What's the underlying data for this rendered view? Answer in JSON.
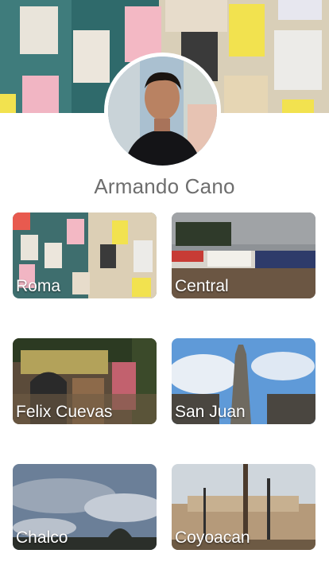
{
  "profile": {
    "name": "Armando Cano"
  },
  "neighborhoods": [
    {
      "label": "Roma"
    },
    {
      "label": "Central"
    },
    {
      "label": "Felix Cuevas"
    },
    {
      "label": "San Juan"
    },
    {
      "label": "Chalco"
    },
    {
      "label": "Coyoacan"
    }
  ],
  "colors": {
    "background": "#ffffff",
    "name_text": "#6e6e6e",
    "tile_label": "#ffffff"
  }
}
